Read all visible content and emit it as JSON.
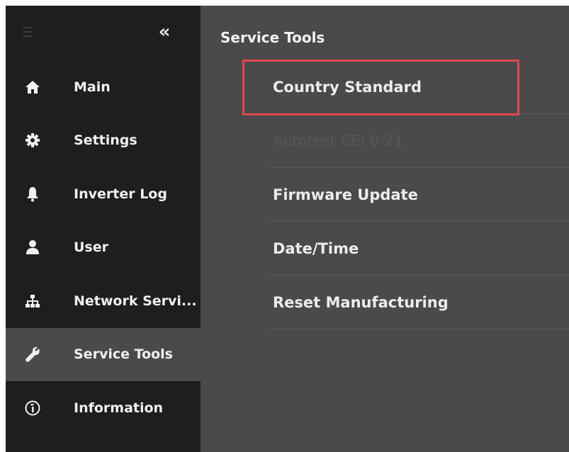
{
  "sidebar": {
    "collapse_label": "«",
    "items": [
      {
        "label": "Main",
        "icon": "home-icon"
      },
      {
        "label": "Settings",
        "icon": "gear-icon"
      },
      {
        "label": "Inverter Log",
        "icon": "bell-icon"
      },
      {
        "label": "User",
        "icon": "user-icon"
      },
      {
        "label": "Network Servi...",
        "icon": "network-icon"
      },
      {
        "label": "Service Tools",
        "icon": "wrench-icon",
        "active": true
      },
      {
        "label": "Information",
        "icon": "info-icon"
      }
    ]
  },
  "main": {
    "title": "Service Tools",
    "items": [
      {
        "label": "Country Standard",
        "highlighted": true
      },
      {
        "label": "Autotest CEI 0-21",
        "disabled": true
      },
      {
        "label": "Firmware Update"
      },
      {
        "label": "Date/Time"
      },
      {
        "label": "Reset Manufacturing"
      }
    ]
  },
  "colors": {
    "sidebar_bg": "#1e1e1e",
    "content_bg": "#4a4a4a",
    "highlight_border": "#e0474c",
    "text": "#f0f0f0",
    "disabled_text": "#575757"
  }
}
